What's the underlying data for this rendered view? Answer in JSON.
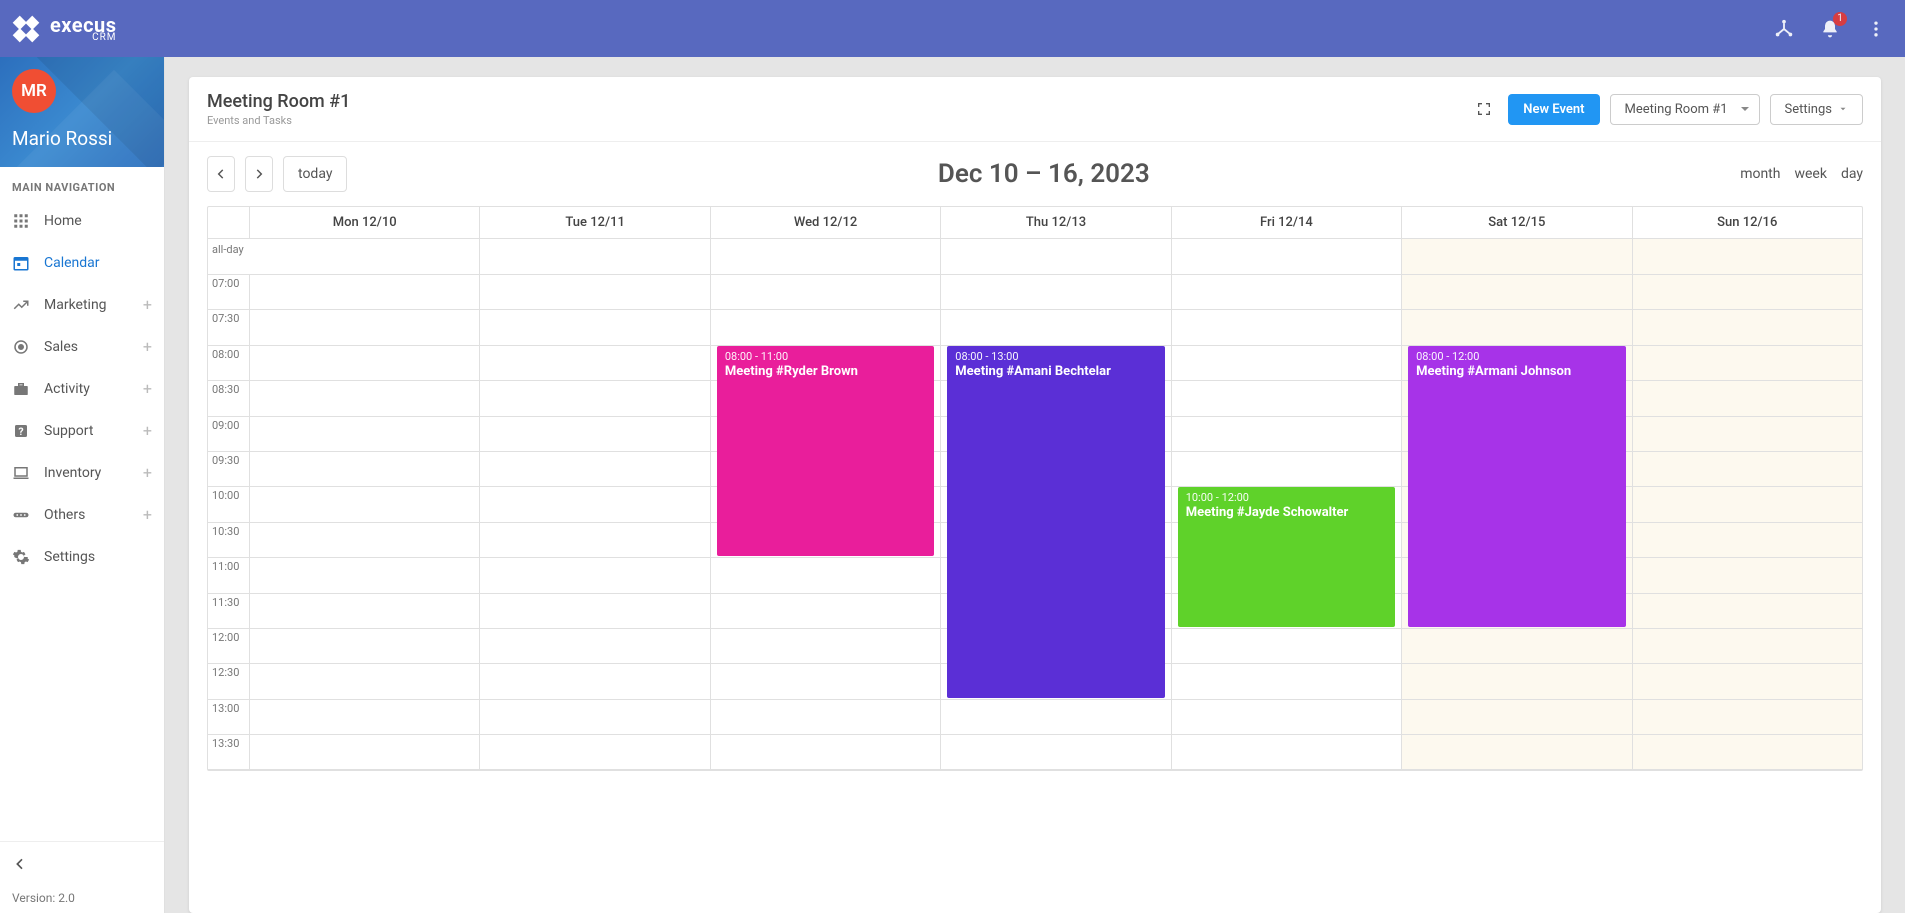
{
  "brand": {
    "name": "execus",
    "suffix": "CRM"
  },
  "notifications": {
    "count": "1"
  },
  "profile": {
    "initials": "MR",
    "name": "Mario Rossi"
  },
  "sidebar": {
    "header": "MAIN NAVIGATION",
    "items": [
      {
        "label": "Home"
      },
      {
        "label": "Calendar"
      },
      {
        "label": "Marketing"
      },
      {
        "label": "Sales"
      },
      {
        "label": "Activity"
      },
      {
        "label": "Support"
      },
      {
        "label": "Inventory"
      },
      {
        "label": "Others"
      },
      {
        "label": "Settings"
      }
    ],
    "version": "Version: 2.0"
  },
  "page": {
    "title": "Meeting Room #1",
    "subtitle": "Events and Tasks",
    "newEvent": "New Event",
    "roomSelector": "Meeting Room #1",
    "settings": "Settings"
  },
  "calendar": {
    "today": "today",
    "range": "Dec 10 – 16, 2023",
    "views": {
      "month": "month",
      "week": "week",
      "day": "day"
    },
    "allday": "all-day",
    "days": [
      "Mon 12/10",
      "Tue 12/11",
      "Wed 12/12",
      "Thu 12/13",
      "Fri 12/14",
      "Sat 12/15",
      "Sun 12/16"
    ],
    "times": [
      "07:00",
      "07:30",
      "08:00",
      "08:30",
      "09:00",
      "09:30",
      "10:00",
      "10:30",
      "11:00",
      "11:30",
      "12:00",
      "12:30",
      "13:00",
      "13:30"
    ],
    "events": [
      {
        "day": 2,
        "start": "08:00",
        "end": "11:00",
        "title": "Meeting #Ryder Brown",
        "timeLabel": "08:00 - 11:00",
        "color": "#e91e9b"
      },
      {
        "day": 3,
        "start": "08:00",
        "end": "13:00",
        "title": "Meeting #Amani Bechtelar",
        "timeLabel": "08:00 - 13:00",
        "color": "#5b2fd6"
      },
      {
        "day": 4,
        "start": "10:00",
        "end": "12:00",
        "title": "Meeting #Jayde Schowalter",
        "timeLabel": "10:00 - 12:00",
        "color": "#5fd22a"
      },
      {
        "day": 5,
        "start": "08:00",
        "end": "12:00",
        "title": "Meeting #Armani Johnson",
        "timeLabel": "08:00 - 12:00",
        "color": "#a733e8"
      }
    ]
  }
}
